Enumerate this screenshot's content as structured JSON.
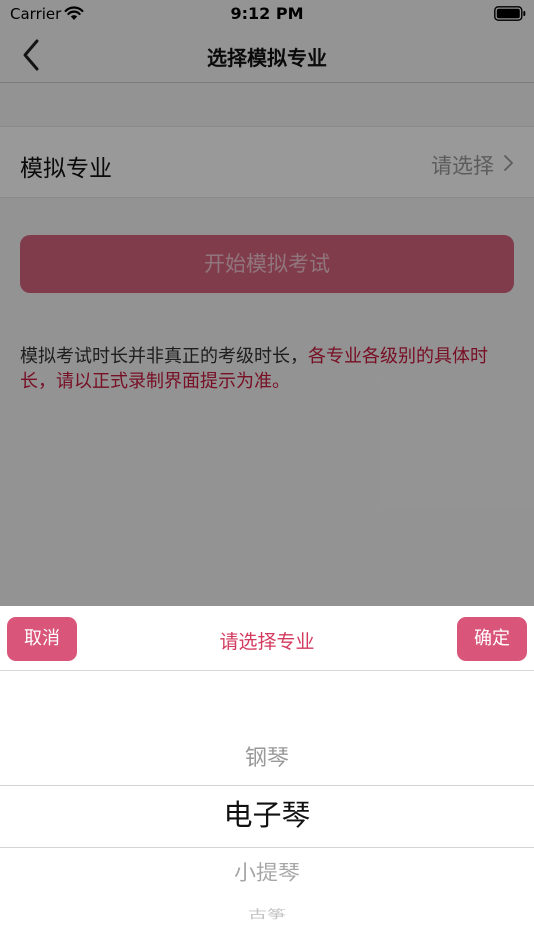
{
  "status_bar": {
    "carrier": "Carrier",
    "time": "9:12 PM"
  },
  "nav": {
    "title": "选择模拟专业"
  },
  "form": {
    "major_label": "模拟专业",
    "major_placeholder": "请选择",
    "start_button": "开始模拟考试"
  },
  "note": {
    "normal": "模拟考试时长并非真正的考级时长，",
    "highlight": "各专业各级别的具体时长，请以正式录制界面提示为准。"
  },
  "picker": {
    "cancel": "取消",
    "title": "请选择专业",
    "confirm": "确定",
    "options": [
      "钢琴",
      "电子琴",
      "小提琴",
      "古筝"
    ],
    "selected": "电子琴"
  },
  "colors": {
    "accent": "#d9557a",
    "highlight_text": "#c7193e",
    "picker_title": "#d43a5e"
  }
}
